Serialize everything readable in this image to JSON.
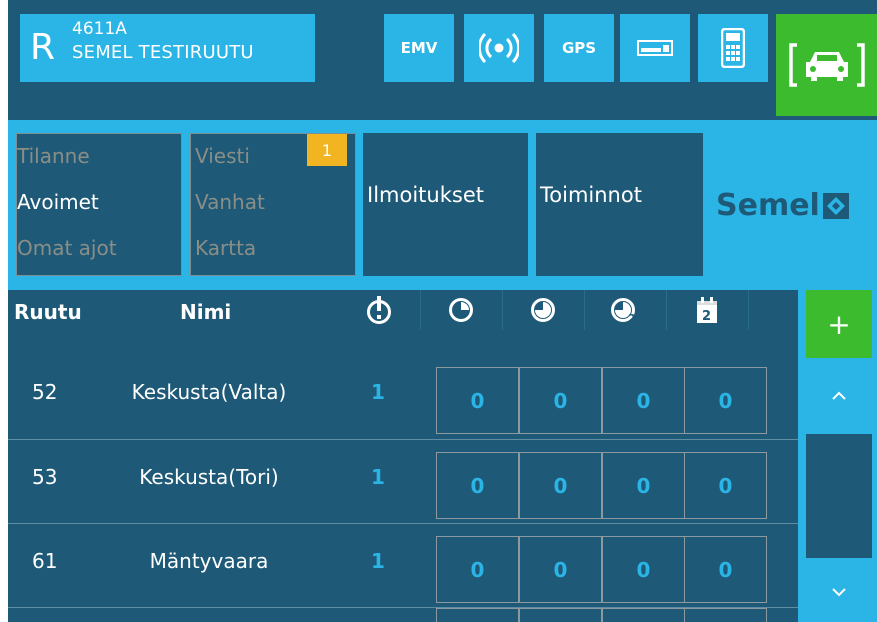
{
  "vehicle": {
    "letter": "R",
    "id": "4611A",
    "name": "SEMEL TESTIRUUTU"
  },
  "toolbar": {
    "emv_label": "EMV",
    "radio_icon": "radio-signal-icon",
    "gps_label": "GPS",
    "card_icon": "card-reader-icon",
    "terminal_icon": "payment-terminal-icon",
    "taxi_icon": "taxi-status-icon"
  },
  "nav": {
    "group1": [
      "Tilanne",
      "Avoimet",
      "Omat ajot"
    ],
    "group2": [
      "Viesti",
      "Vanhat",
      "Kartta"
    ],
    "viesti_badge": "1",
    "ilmoitukset": "Ilmoitukset",
    "toiminnot": "Toiminnot",
    "brand": "Semel"
  },
  "table": {
    "headers": {
      "ruutu": "Ruutu",
      "nimi": "Nimi",
      "icons": [
        "alert-icon",
        "clock-icon",
        "timer-icon",
        "clock-2-icon",
        "calendar-2-icon"
      ]
    },
    "rows": [
      {
        "ruutu": "52",
        "nimi": "Keskusta(Valta)",
        "count": "1",
        "values": [
          "0",
          "0",
          "0",
          "0"
        ]
      },
      {
        "ruutu": "53",
        "nimi": "Keskusta(Tori)",
        "count": "1",
        "values": [
          "0",
          "0",
          "0",
          "0"
        ]
      },
      {
        "ruutu": "61",
        "nimi": "Mäntyvaara",
        "count": "1",
        "values": [
          "0",
          "0",
          "0",
          "0"
        ]
      }
    ]
  },
  "side": {
    "add_label": "+",
    "up_icon": "chevron-up-icon",
    "down_icon": "chevron-down-icon"
  },
  "colors": {
    "dark": "#1e5a78",
    "accent": "#2ab5e6",
    "green": "#3dbb2f",
    "badge": "#f0b521"
  }
}
